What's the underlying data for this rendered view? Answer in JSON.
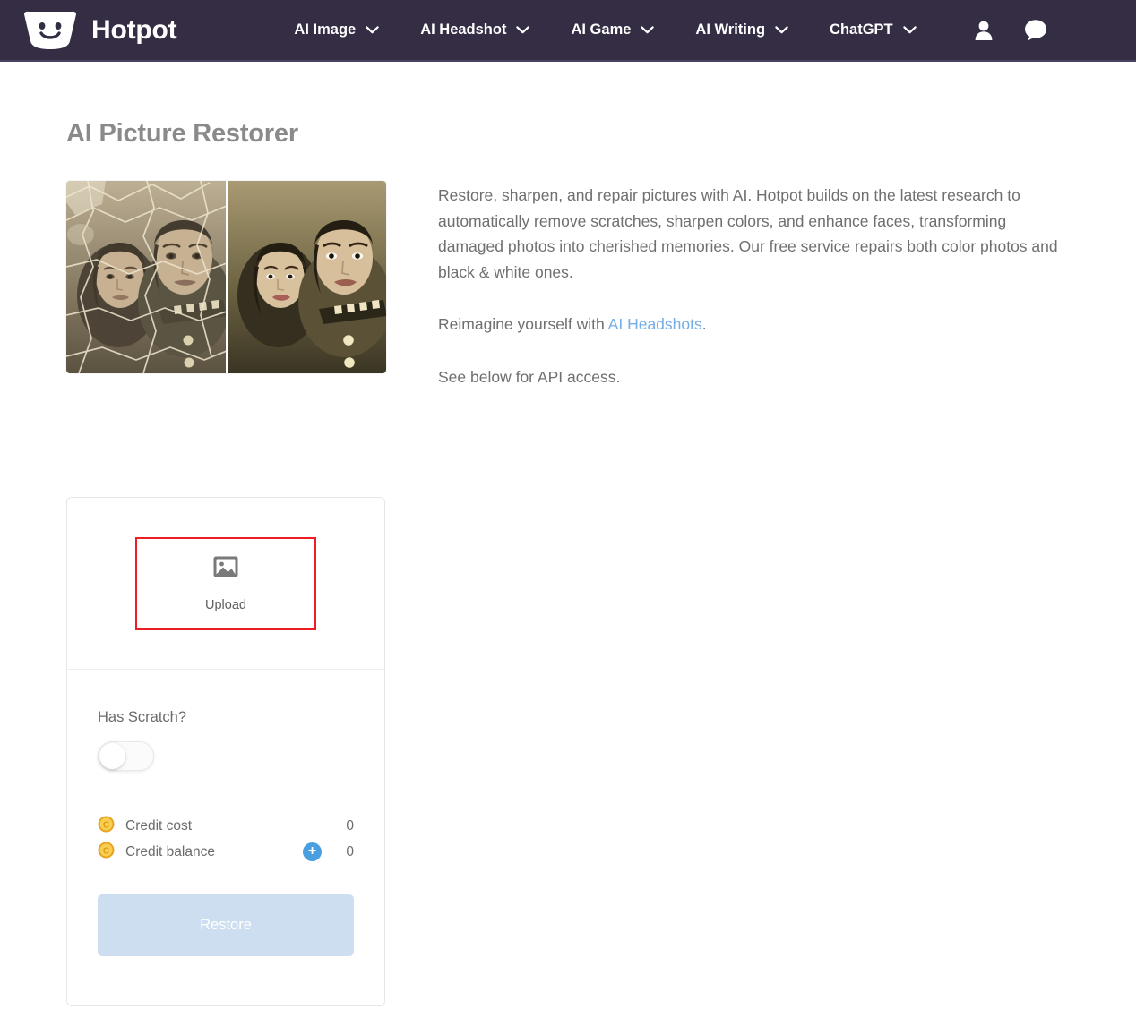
{
  "navbar": {
    "brand": {
      "name": "Hotpot",
      "logo_icon": "hotpot-smiling-pot-logo"
    },
    "links": [
      {
        "label": "AI Image",
        "icon": "chevron-down-icon"
      },
      {
        "label": "AI Headshot",
        "icon": "chevron-down-icon"
      },
      {
        "label": "AI Game",
        "icon": "chevron-down-icon"
      },
      {
        "label": "AI Writing",
        "icon": "chevron-down-icon"
      },
      {
        "label": "ChatGPT",
        "icon": "chevron-down-icon"
      }
    ],
    "icons": [
      {
        "name": "account-icon"
      },
      {
        "name": "chat-bubble-icon"
      }
    ],
    "background_color": "#342d44"
  },
  "page": {
    "title": "AI Picture Restorer"
  },
  "hero": {
    "image_alt": "Before and after restoration of a damaged vintage sepia photo of a young woman and a man in uniform",
    "paragraph1": "Restore, sharpen, and repair pictures with AI. Hotpot builds on the latest research to automatically remove scratches, sharpen colors, and enhance faces, transforming damaged photos into cherished memories. Our free service repairs both color photos and black & white ones.",
    "paragraph2_prefix": "Reimagine yourself with ",
    "paragraph2_link": "AI Headshots",
    "paragraph2_suffix": ".",
    "paragraph3": "See below for API access.",
    "link_color": "#74aee8"
  },
  "tool": {
    "upload": {
      "label": "Upload",
      "icon": "image-placeholder-icon",
      "highlight_color": "#ee1c25"
    },
    "has_scratch": {
      "label": "Has Scratch?",
      "value": "off"
    },
    "credits": {
      "cost_label": "Credit cost",
      "cost_value": "0",
      "balance_label": "Credit balance",
      "balance_value": "0",
      "add_button_icon": "plus-icon",
      "coin_icon": "credit-coin-icon",
      "coin_color": "#f5c33b",
      "add_button_color": "#4a9fe0"
    },
    "submit": {
      "label": "Restore",
      "disabled_color": "#cddef0"
    }
  }
}
